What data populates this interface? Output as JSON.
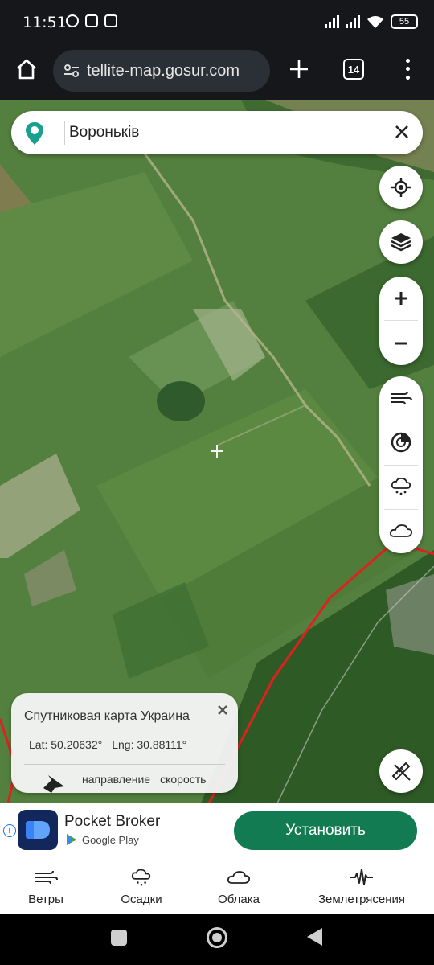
{
  "status_bar": {
    "time": "11:51",
    "battery": "55",
    "icons": [
      "viber-icon",
      "message-icon",
      "upload-icon",
      "signal-icon",
      "signal-icon",
      "wifi-icon",
      "battery-icon"
    ]
  },
  "browser": {
    "url": "tellite-map.gosur.com",
    "tab_count": "14"
  },
  "map": {
    "search_query": "Вороньків",
    "info_card": {
      "title": "Спутниковая карта Украина",
      "lat": "Lat: 50.20632°",
      "lng": "Lng: 30.88111°",
      "label_direction": "направление",
      "label_speed": "скорость"
    },
    "boundary_color": "#e02020"
  },
  "ad": {
    "app_name": "Pocket Broker",
    "store": "Google Play",
    "install_label": "Установить",
    "accent_color": "#137b51"
  },
  "tabs": [
    {
      "label": "Ветры",
      "icon": "wind-icon"
    },
    {
      "label": "Осадки",
      "icon": "rain-cloud-icon"
    },
    {
      "label": "Облака",
      "icon": "cloud-icon"
    },
    {
      "label": "Землетрясения",
      "icon": "seismic-icon"
    }
  ]
}
